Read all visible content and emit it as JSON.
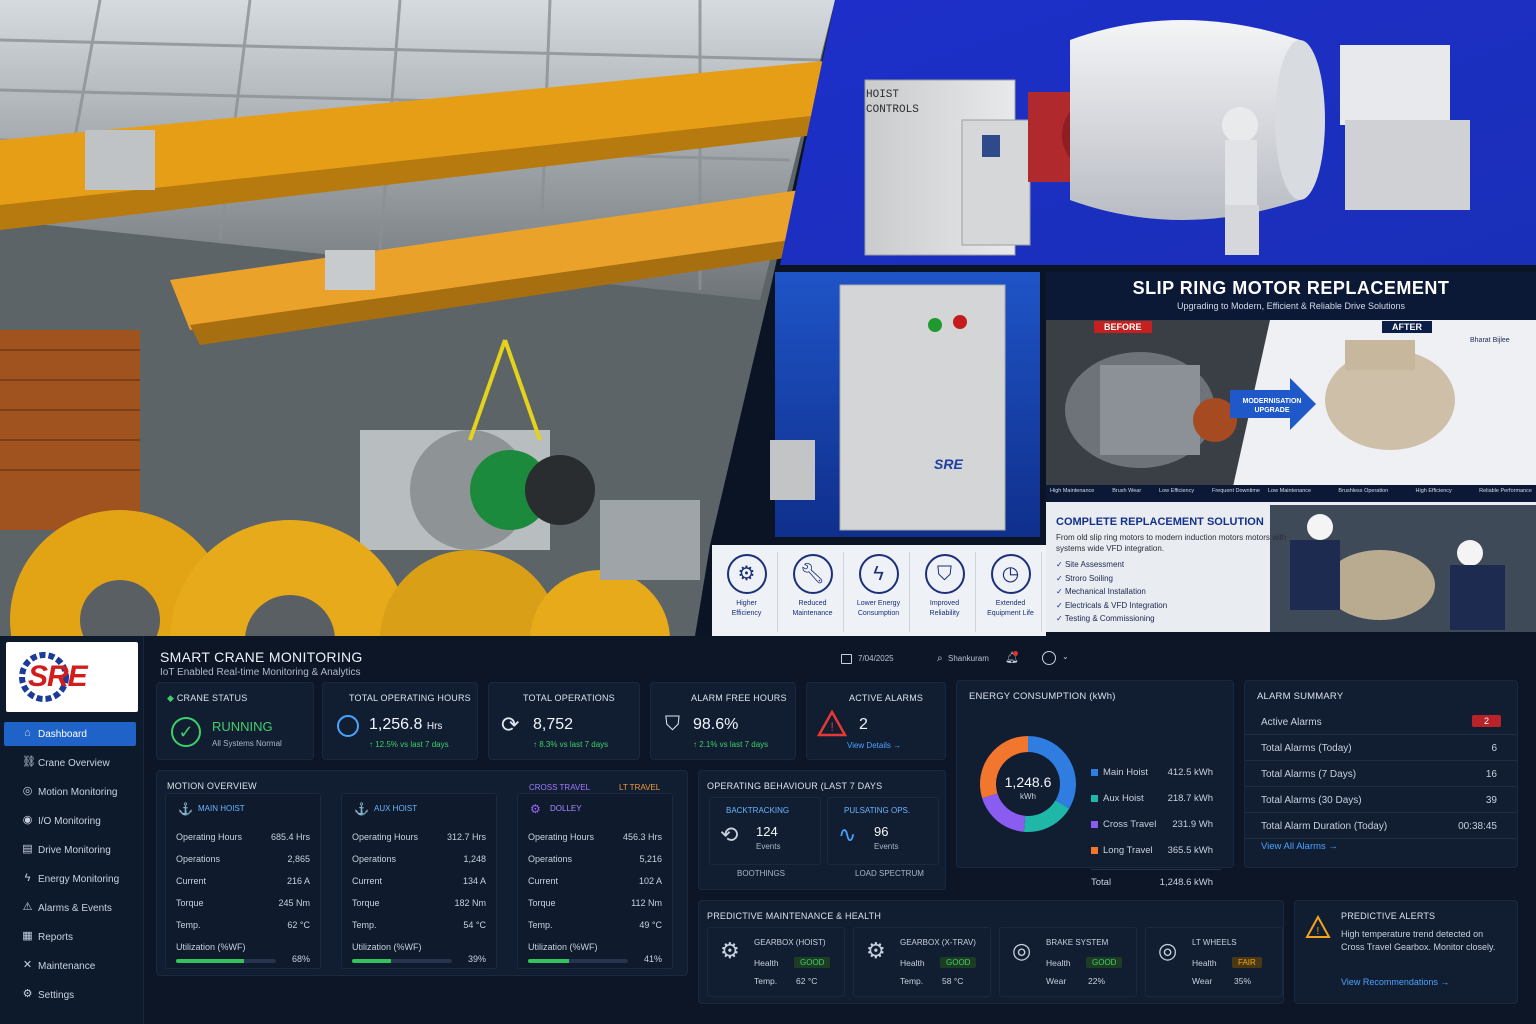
{
  "hero": {
    "panel_top_label": "HOIST\nCONTROLS",
    "replacement_title": "SLIP RING MOTOR REPLACEMENT",
    "replacement_subtitle": "Upgrading to Modern, Efficient & Reliable Drive Solutions",
    "before_label": "BEFORE",
    "after_label": "AFTER",
    "brand_tag": "Bharat Bijlee",
    "arrow_label": "MODERNISATION\nUPGRADE",
    "before_features": [
      "High Maintenance",
      "Brush Wear",
      "Low Efficiency",
      "Frequent Downtime"
    ],
    "after_features": [
      "Low Maintenance",
      "Brushless Operation",
      "High Efficiency",
      "Reliable Performance"
    ],
    "solution_title": "COMPLETE REPLACEMENT SOLUTION",
    "solution_desc": "From old slip ring motors to modern induction motors motors with systems wide VFD integration.",
    "solution_items": [
      "Site Assessment",
      "Stroro Soiling",
      "Mechanical Installation",
      "Electricals & VFD Integration",
      "Testing & Commissioning"
    ],
    "benefits": [
      {
        "label": "Higher\nEfficiency",
        "icon": "gear-icon"
      },
      {
        "label": "Reduced\nMaintenance",
        "icon": "wrench-icon"
      },
      {
        "label": "Lower Energy\nConsumption",
        "icon": "bolt-icon"
      },
      {
        "label": "Improved\nReliability",
        "icon": "shield-icon"
      },
      {
        "label": "Extended\nEquipment Life",
        "icon": "clock-icon"
      }
    ],
    "box_logo": "SRE"
  },
  "app": {
    "logo": "SRE",
    "title": "SMART CRANE MONITORING",
    "subtitle": "IoT Enabled Real-time Monitoring & Analytics",
    "header_items": [
      "7/04/2025",
      "Shankuram"
    ]
  },
  "sidebar": {
    "items": [
      {
        "label": "Dashboard",
        "icon": "home-icon",
        "active": true
      },
      {
        "label": "Crane Overview",
        "icon": "crane-icon"
      },
      {
        "label": "Motion Monitoring",
        "icon": "motion-icon"
      },
      {
        "label": "I/O Monitoring",
        "icon": "io-icon"
      },
      {
        "label": "Drive Monitoring",
        "icon": "drive-icon"
      },
      {
        "label": "Energy Monitoring",
        "icon": "energy-icon"
      },
      {
        "label": "Alarms & Events",
        "icon": "alarm-icon"
      },
      {
        "label": "Reports",
        "icon": "report-icon"
      },
      {
        "label": "Maintenance",
        "icon": "tools-icon"
      },
      {
        "label": "Settings",
        "icon": "gear-icon"
      }
    ]
  },
  "kpis": {
    "crane_status": {
      "title": "CRANE STATUS",
      "value": "RUNNING",
      "note": "All Systems Normal"
    },
    "hours": {
      "title": "TOTAL OPERATING HOURS",
      "value": "1,256.8",
      "unit": "Hrs",
      "trend": "↑ 12.5% vs last 7 days"
    },
    "operations": {
      "title": "TOTAL OPERATIONS",
      "value": "8,752",
      "trend": "↑ 8.3% vs last 7 days"
    },
    "alarm_free": {
      "title": "ALARM FREE HOURS",
      "value": "98.6%",
      "trend": "↑ 2.1% vs last 7 days"
    },
    "alarms": {
      "title": "ACTIVE ALARMS",
      "value": "2",
      "link": "View Details →"
    }
  },
  "energy": {
    "title": "ENERGY CONSUMPTION (kWh)",
    "center_value": "1,248.6",
    "center_unit": "kWh",
    "items": [
      {
        "name": "Main Hoist",
        "value": "412.5 kWh",
        "num": 412.5,
        "color": "#2f7de1"
      },
      {
        "name": "Aux Hoist",
        "value": "218.7 kWh",
        "num": 218.7,
        "color": "#1fb8a8"
      },
      {
        "name": "Cross Travel",
        "value": "231.9 Wh",
        "num": 231.9,
        "color": "#8a5cf0"
      },
      {
        "name": "Long Travel",
        "value": "365.5 kWh",
        "num": 365.5,
        "color": "#f2762e"
      }
    ],
    "total_label": "Total",
    "total_value": "1,248.6 kWh"
  },
  "alarm_summary": {
    "title": "ALARM SUMMARY",
    "rows": [
      {
        "k": "Active Alarms",
        "v": "2",
        "badge": true
      },
      {
        "k": "Total Alarms (Today)",
        "v": "6"
      },
      {
        "k": "Total Alarms (7 Days)",
        "v": "16"
      },
      {
        "k": "Total Alarms (30 Days)",
        "v": "39"
      },
      {
        "k": "Total Alarm Duration (Today)",
        "v": "00:38:45"
      }
    ],
    "link": "View All Alarms →"
  },
  "motion": {
    "title": "MOTION OVERVIEW",
    "tags": [
      "CROSS TRAVEL",
      "LT TRAVEL"
    ],
    "columns": [
      {
        "name": "MAIN HOIST",
        "rows": [
          [
            "Operating Hours",
            "685.4 Hrs"
          ],
          [
            "Operations",
            "2,865"
          ],
          [
            "Current",
            "216 A"
          ],
          [
            "Torque",
            "245 Nm"
          ],
          [
            "Temp.",
            "62 °C"
          ]
        ],
        "util_label": "Utilization (%WF)",
        "util": "68%",
        "util_num": 68
      },
      {
        "name": "AUX HOIST",
        "rows": [
          [
            "Operating Hours",
            "312.7 Hrs"
          ],
          [
            "Operations",
            "1,248"
          ],
          [
            "Current",
            "134 A"
          ],
          [
            "Torque",
            "182 Nm"
          ],
          [
            "Temp.",
            "54 °C"
          ]
        ],
        "util_label": "Utilization (%WF)",
        "util": "39%",
        "util_num": 39
      },
      {
        "name": "DOLLEY",
        "rows": [
          [
            "Operating Hours",
            "456.3 Hrs"
          ],
          [
            "Operations",
            "5,216"
          ],
          [
            "Current",
            "102 A"
          ],
          [
            "Torque",
            "112 Nm"
          ],
          [
            "Temp.",
            "49 °C"
          ]
        ],
        "util_label": "Utilization (%WF)",
        "util": "41%",
        "util_num": 41
      }
    ]
  },
  "behaviour": {
    "title": "OPERATING BEHAVIOUR (LAST 7 DAYS",
    "items": [
      {
        "name": "BACKTRACKING",
        "value": "124",
        "unit": "Events",
        "footer": "BOOTHINGS"
      },
      {
        "name": "PULSATING OPS.",
        "value": "96",
        "unit": "Events",
        "footer": "LOAD SPECTRUM"
      }
    ]
  },
  "predictive": {
    "title": "PREDICTIVE MAINTENANCE & HEALTH",
    "items": [
      {
        "name": "GEARBOX (HOIST)",
        "r1k": "Health",
        "r1v": "GOOD",
        "r2k": "Temp.",
        "r2v": "62 °C"
      },
      {
        "name": "GEARBOX (X-TRAV)",
        "r1k": "Health",
        "r1v": "GOOD",
        "r2k": "Temp.",
        "r2v": "58 °C"
      },
      {
        "name": "BRAKE SYSTEM",
        "r1k": "Health",
        "r1v": "GOOD",
        "r2k": "Wear",
        "r2v": "22%"
      },
      {
        "name": "LT WHEELS",
        "r1k": "Health",
        "r1v": "FAIR",
        "r2k": "Wear",
        "r2v": "35%"
      }
    ]
  },
  "alerts": {
    "title": "PREDICTIVE ALERTS",
    "text": "High temperature trend detected on Cross Travel Gearbox. Monitor closely.",
    "link": "View Recommendations →"
  }
}
